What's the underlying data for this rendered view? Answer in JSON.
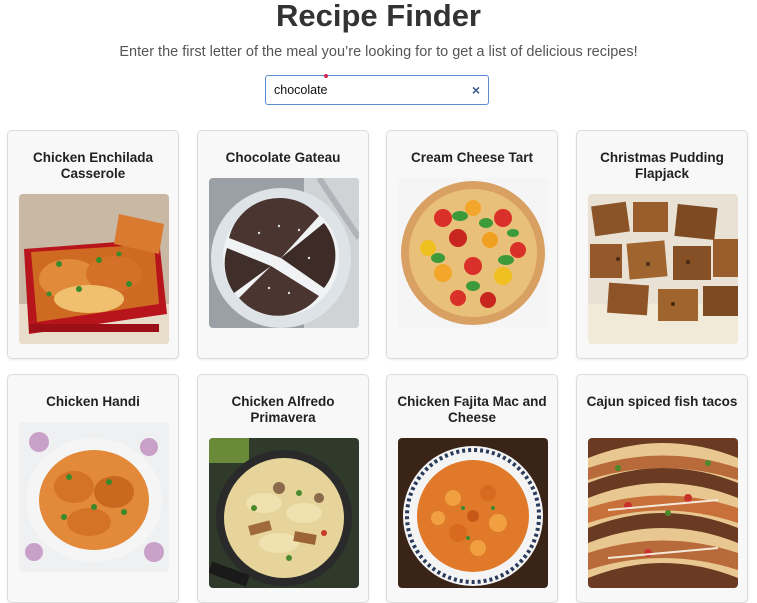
{
  "header": {
    "title": "Recipe Finder",
    "subtitle": "Enter the first letter of the meal you’re looking for to get a list of delicious recipes!"
  },
  "search": {
    "value": "chocolate",
    "clear_icon": "×"
  },
  "recipes": [
    {
      "name": "Chicken Enchilada Casserole",
      "image_icon": "casserole-image"
    },
    {
      "name": "Chocolate Gateau",
      "image_icon": "chocolate-cake-image"
    },
    {
      "name": "Cream Cheese Tart",
      "image_icon": "tomato-tart-image"
    },
    {
      "name": "Christmas Pudding Flapjack",
      "image_icon": "flapjack-image"
    },
    {
      "name": "Chicken Handi",
      "image_icon": "curry-image"
    },
    {
      "name": "Chicken Alfredo Primavera",
      "image_icon": "pasta-pan-image"
    },
    {
      "name": "Chicken Fajita Mac and Cheese",
      "image_icon": "mac-cheese-image"
    },
    {
      "name": "Cajun spiced fish tacos",
      "image_icon": "fish-tacos-image"
    }
  ],
  "colors": {
    "accent": "#5b8cd6",
    "card_bg": "#f8f8f8",
    "title": "#333333"
  }
}
